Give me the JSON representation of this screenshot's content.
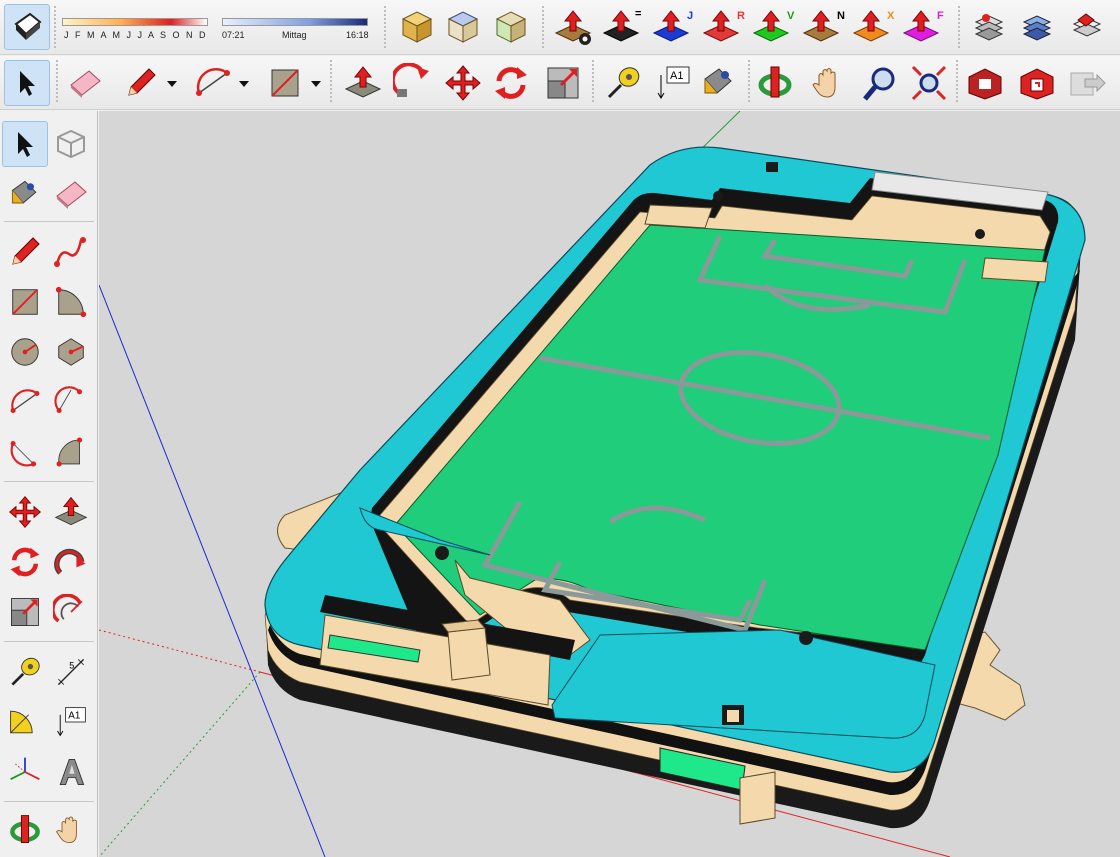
{
  "app": {
    "name": "SketchUp-style 3D modeler",
    "accent": "#1fc8d3",
    "field_color": "#1fcd7a",
    "selection_color": "#cfe3f7"
  },
  "shadow_settings": {
    "months_label": "J F M A M J J A S O N D",
    "time_start": "07:21",
    "time_mid": "Mittag",
    "time_end": "16:18"
  },
  "toolbar_top": {
    "items": [
      {
        "icon": "eraser-style-icon"
      },
      {
        "icon": "view-iso-icon"
      },
      {
        "icon": "view-top-icon"
      },
      {
        "icon": "view-front-icon"
      },
      {
        "icon": "push-pull-settings-icon"
      },
      {
        "icon": "push-pull-equal-icon",
        "badge": "="
      },
      {
        "icon": "push-pull-j-icon",
        "badge": "J"
      },
      {
        "icon": "push-pull-r-icon",
        "badge": "R"
      },
      {
        "icon": "push-pull-v-icon",
        "badge": "V"
      },
      {
        "icon": "push-pull-n-icon",
        "badge": "N"
      },
      {
        "icon": "push-pull-x-icon",
        "badge": "X"
      },
      {
        "icon": "push-pull-f-icon",
        "badge": "F"
      },
      {
        "icon": "layers-icon"
      },
      {
        "icon": "layers-blue-icon"
      },
      {
        "icon": "layers-red-icon"
      }
    ]
  },
  "toolbar_main": {
    "items": [
      {
        "icon": "select-arrow-icon",
        "selected": true
      },
      {
        "icon": "eraser-icon"
      },
      {
        "icon": "pencil-icon"
      },
      {
        "icon": "dropdown-arrow-icon"
      },
      {
        "icon": "arc-icon"
      },
      {
        "icon": "dropdown-arrow-icon"
      },
      {
        "icon": "rectangle-icon"
      },
      {
        "icon": "dropdown-arrow-icon"
      },
      {
        "icon": "push-pull-icon"
      },
      {
        "icon": "follow-me-icon"
      },
      {
        "icon": "move-icon"
      },
      {
        "icon": "rotate-icon"
      },
      {
        "icon": "scale-icon"
      },
      {
        "icon": "tape-measure-icon"
      },
      {
        "icon": "text-label-icon",
        "label": "A1"
      },
      {
        "icon": "paint-bucket-icon"
      },
      {
        "icon": "orbit-icon"
      },
      {
        "icon": "pan-hand-icon"
      },
      {
        "icon": "zoom-icon"
      },
      {
        "icon": "zoom-extents-icon"
      },
      {
        "icon": "warehouse-icon"
      },
      {
        "icon": "extension-warehouse-icon"
      },
      {
        "icon": "send-to-layout-icon"
      }
    ]
  },
  "left_toolbar": {
    "text_label": "A1"
  }
}
